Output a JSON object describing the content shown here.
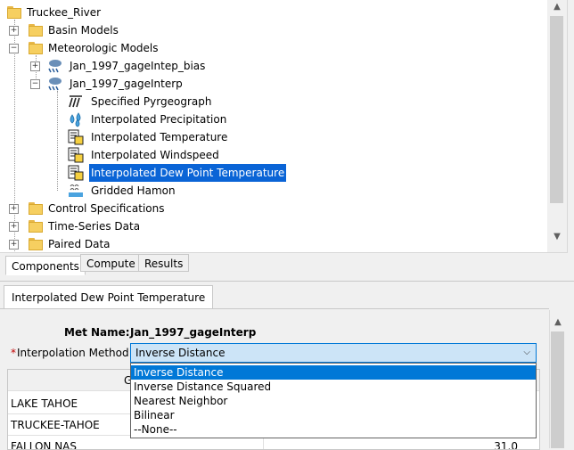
{
  "tree": {
    "root": "Truckee_River",
    "basin_models": "Basin Models",
    "meteorologic_models": "Meteorologic Models",
    "met1": "Jan_1997_gageIntep_bias",
    "met2": "Jan_1997_gageInterp",
    "children": [
      "Specified Pyrgeograph",
      "Interpolated Precipitation",
      "Interpolated Temperature",
      "Interpolated Windspeed",
      "Interpolated Dew Point Temperature",
      "Gridded Hamon"
    ],
    "control_specs": "Control Specifications",
    "time_series": "Time-Series Data",
    "paired_data": "Paired Data"
  },
  "tabs": [
    "Components",
    "Compute",
    "Results"
  ],
  "panel": {
    "tab_title": "Interpolated Dew Point Temperature",
    "met_name_label": "Met Name:",
    "met_name_value": "Jan_1997_gageInterp",
    "required_mark": "*",
    "interp_label": "Interpolation Method:",
    "interp_value": "Inverse Distance",
    "options": [
      "Inverse Distance",
      "Inverse Distance Squared",
      "Nearest Neighbor",
      "Bilinear",
      "--None--"
    ],
    "table_header_fragment": "G",
    "stations": [
      "LAKE TAHOE",
      "TRUCKEE-TAHOE",
      "FALLON NAS"
    ],
    "fallon_value": "31.0"
  },
  "colors": {
    "selection": "#0a64d6",
    "combo_bg": "#cce4f7",
    "required": "#c00000"
  }
}
